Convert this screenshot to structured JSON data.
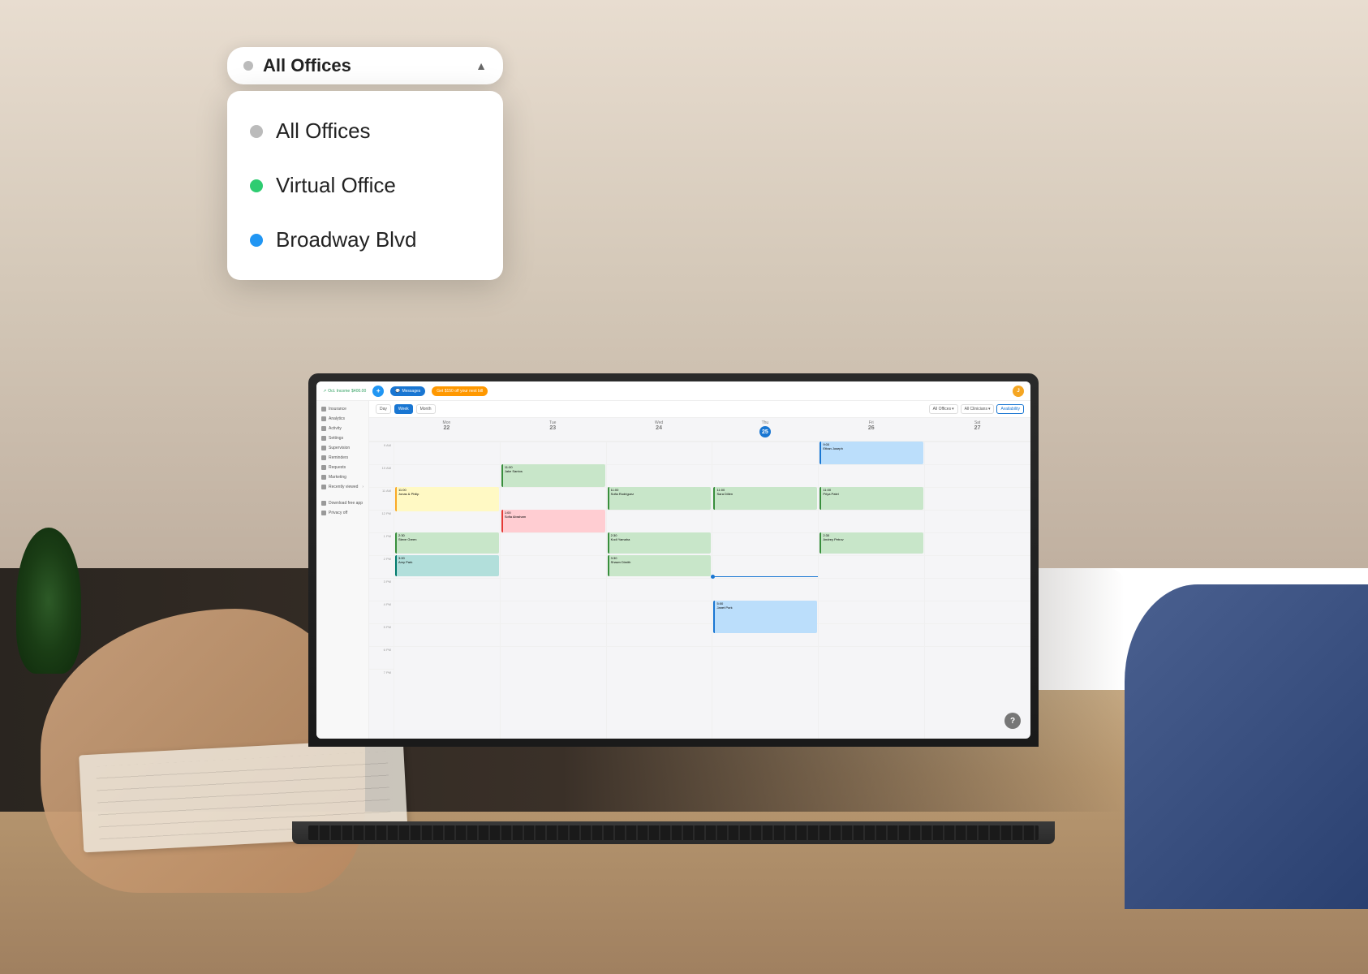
{
  "background": {
    "desc": "Person at wooden desk with laptop, warm interior setting"
  },
  "selector": {
    "trigger_label": "All Offices",
    "chevron": "▲",
    "dot_color": "gray"
  },
  "dropdown": {
    "items": [
      {
        "label": "All Offices",
        "dot_class": "dot-gray"
      },
      {
        "label": "Virtual Office",
        "dot_class": "dot-green"
      },
      {
        "label": "Broadway Blvd",
        "dot_class": "dot-blue"
      }
    ]
  },
  "app": {
    "topbar": {
      "income_label": "Oct. Income",
      "income_value": "$400.00",
      "messages_label": "Messages",
      "promo_label": "Get $150 off your next bill",
      "avatar_label": "J"
    },
    "sidebar": {
      "items": [
        {
          "label": "Insurance"
        },
        {
          "label": "Analytics"
        },
        {
          "label": "Activity"
        },
        {
          "label": "Settings"
        },
        {
          "label": "Supervision"
        },
        {
          "label": "Reminders"
        },
        {
          "label": "Requests"
        },
        {
          "label": "Marketing"
        },
        {
          "label": "Recently viewed"
        },
        {
          "label": "Download free app"
        },
        {
          "label": "Privacy off"
        }
      ]
    },
    "calendar": {
      "view_day": "Day",
      "view_week": "Week",
      "view_month": "Month",
      "filter_offices": "All Offices",
      "filter_clinicians": "All Clinicians",
      "availability_btn": "Availability",
      "days": [
        {
          "label": "Mon",
          "num": "22",
          "today": false
        },
        {
          "label": "Tue",
          "num": "23",
          "today": false
        },
        {
          "label": "Wed",
          "num": "24",
          "today": false
        },
        {
          "label": "Thu",
          "num": "25",
          "today": true
        },
        {
          "label": "Fri",
          "num": "26",
          "today": false
        },
        {
          "label": "Sat",
          "num": "27",
          "today": false
        }
      ],
      "times": [
        "9 AM",
        "10 AM",
        "11 AM",
        "12 PM",
        "1 PM",
        "2 PM",
        "3 PM",
        "4 PM",
        "5 PM",
        "6 PM",
        "7 PM"
      ]
    }
  }
}
